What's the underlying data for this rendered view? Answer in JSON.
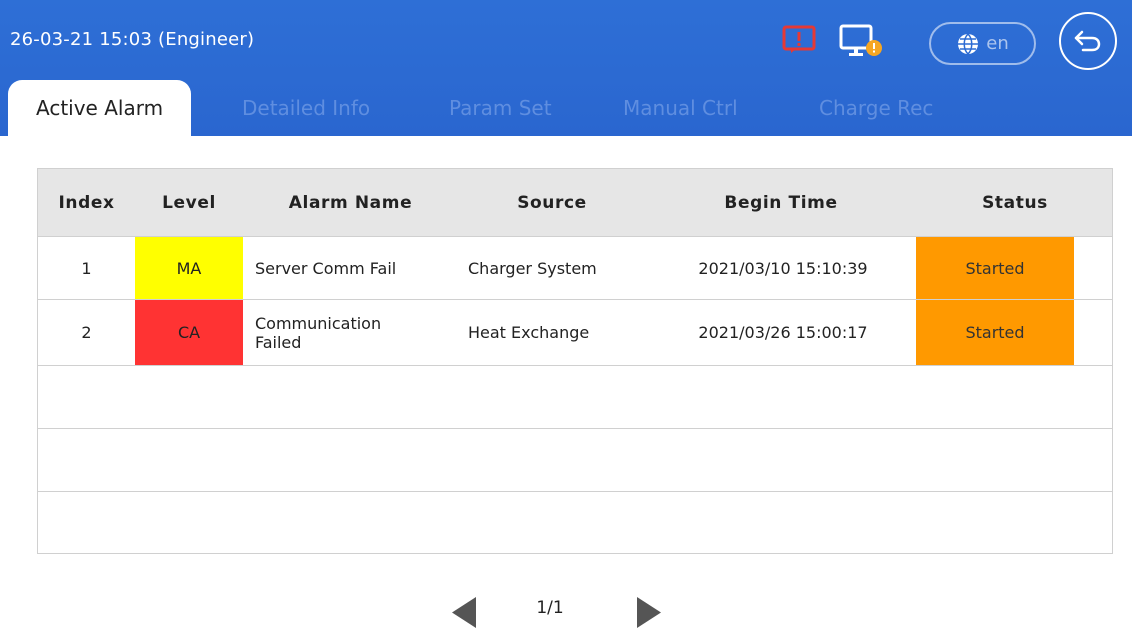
{
  "header": {
    "datetime": "26-03-21  15:03 (Engineer)",
    "language": "en",
    "icons": {
      "alarm": "alarm-bell-icon",
      "monitor": "monitor-warning-icon",
      "language": "globe-icon",
      "back": "back-arrow-icon"
    }
  },
  "tabs": [
    {
      "label": "Active Alarm",
      "active": true
    },
    {
      "label": "Detailed Info",
      "active": false
    },
    {
      "label": "Param Set",
      "active": false
    },
    {
      "label": "Manual Ctrl",
      "active": false
    },
    {
      "label": "Charge Rec",
      "active": false
    }
  ],
  "table": {
    "columns": [
      "Index",
      "Level",
      "Alarm Name",
      "Source",
      "Begin Time",
      "Status"
    ],
    "rows": [
      {
        "index": "1",
        "level": "MA",
        "level_color": "#ffff00",
        "alarm_name": "Server Comm Fail",
        "source": "Charger System",
        "begin_time": "2021/03/10 15:10:39",
        "status": "Started",
        "status_color": "#ff9900"
      },
      {
        "index": "2",
        "level": "CA",
        "level_color": "#ff3333",
        "alarm_name": "Communication Failed",
        "source": "Heat Exchange",
        "begin_time": "2021/03/26 15:00:17",
        "status": "Started",
        "status_color": "#ff9900"
      }
    ]
  },
  "pager": {
    "page": "1/1",
    "prev_icon": "triangle-left-icon",
    "next_icon": "triangle-right-icon"
  },
  "colors": {
    "header_bg": "#2c6bd3",
    "tab_inactive": "#5f8ee0",
    "alarm_icon": "#e53935",
    "monitor_badge": "#f5a623"
  }
}
